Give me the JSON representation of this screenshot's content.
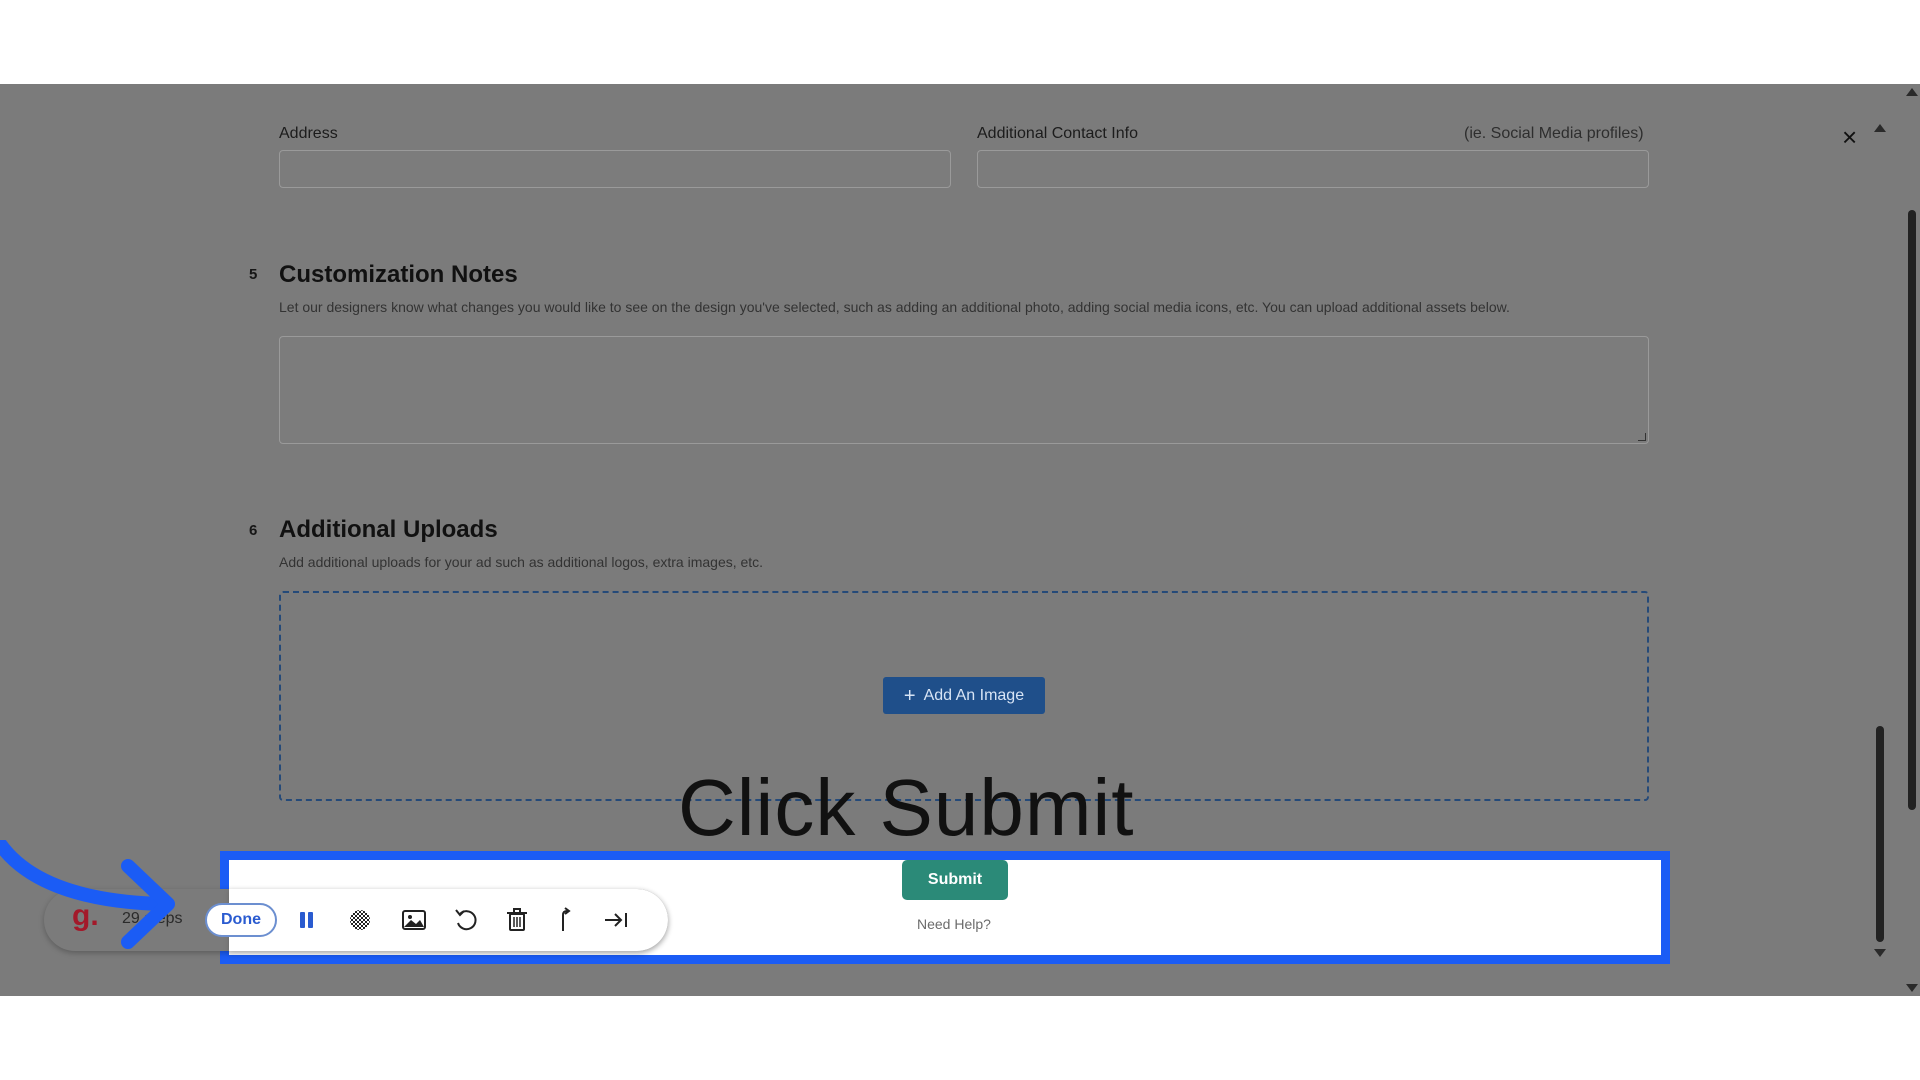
{
  "modal": {
    "address_label": "Address",
    "contact_label": "Additional Contact Info",
    "contact_hint": "(ie. Social Media profiles)",
    "close_icon": "close-icon"
  },
  "customization": {
    "step": "5",
    "title": "Customization Notes",
    "description": "Let our designers know what changes you would like to see on the design you've selected, such as adding an additional photo, adding social media icons, etc. You can upload additional assets below."
  },
  "uploads": {
    "step": "6",
    "title": "Additional Uploads",
    "description": "Add additional uploads for your ad such as additional logos, extra images, etc.",
    "add_button": "Add An Image"
  },
  "footer": {
    "submit": "Submit",
    "help": "Need Help?"
  },
  "overlay": {
    "caption": "Click Submit",
    "highlight_color": "#1b5cf5",
    "arrow_color": "#1b5cf5"
  },
  "recorder": {
    "logo": "g.",
    "steps": "29 steps",
    "done": "Done",
    "tools": [
      "pause-icon",
      "blur-icon",
      "image-icon",
      "undo-icon",
      "trash-icon",
      "branch-icon",
      "skip-icon"
    ]
  },
  "colors": {
    "dim_overlay": "#7b7b7b",
    "submit_bg": "#2b8a78",
    "add_button_bg": "#1f4f8a"
  }
}
